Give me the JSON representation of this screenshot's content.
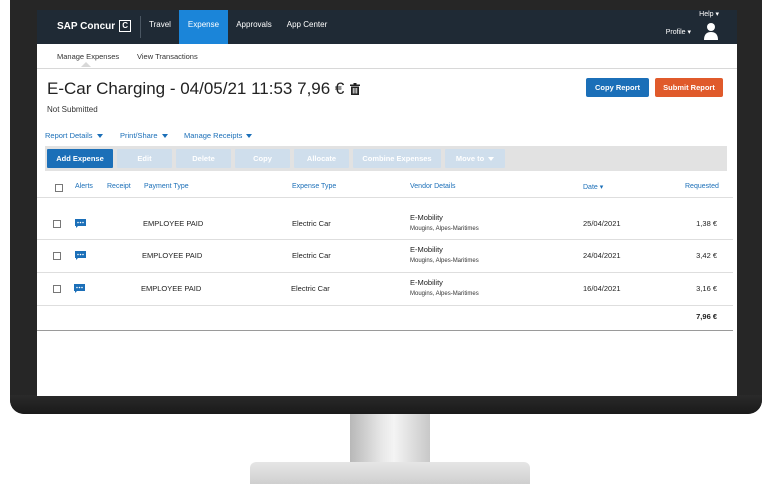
{
  "brand": {
    "name": "SAP Concur",
    "mark": "C"
  },
  "topnav": {
    "items": [
      {
        "label": "Travel"
      },
      {
        "label": "Expense"
      },
      {
        "label": "Approvals"
      },
      {
        "label": "App Center"
      }
    ],
    "help_label": "Help ▾",
    "profile_label": "Profile ▾"
  },
  "subnav": {
    "items": [
      {
        "label": "Manage Expenses"
      },
      {
        "label": "View Transactions"
      }
    ]
  },
  "report": {
    "title": "E-Car Charging - 04/05/21 11:53 7,96 €",
    "status": "Not Submitted",
    "copy_label": "Copy Report",
    "submit_label": "Submit Report"
  },
  "menus": [
    {
      "label": "Report Details"
    },
    {
      "label": "Print/Share"
    },
    {
      "label": "Manage Receipts"
    }
  ],
  "toolbar": {
    "add_expense": "Add Expense",
    "edit": "Edit",
    "delete": "Delete",
    "copy": "Copy",
    "allocate": "Allocate",
    "combine": "Combine Expenses",
    "move_to": "Move to"
  },
  "table": {
    "headers": {
      "alerts": "Alerts",
      "receipt": "Receipt",
      "payment_type": "Payment Type",
      "expense_type": "Expense Type",
      "vendor": "Vendor Details",
      "date": "Date ▾",
      "requested": "Requested"
    },
    "rows": [
      {
        "payment_type": "EMPLOYEE PAID",
        "expense_type": "Electric Car",
        "vendor": "E-Mobility",
        "location": "Mougins, Alpes-Maritimes",
        "date": "25/04/2021",
        "amount": "1,38 €"
      },
      {
        "payment_type": "EMPLOYEE PAID",
        "expense_type": "Electric Car",
        "vendor": "E-Mobility",
        "location": "Mougins, Alpes-Maritimes",
        "date": "24/04/2021",
        "amount": "3,42 €"
      },
      {
        "payment_type": "EMPLOYEE PAID",
        "expense_type": "Electric Car",
        "vendor": "E-Mobility",
        "location": "Mougins, Alpes-Maritimes",
        "date": "16/04/2021",
        "amount": "3,16 €"
      }
    ],
    "total": "7,96 €"
  },
  "colors": {
    "nav_bg": "#1f2a35",
    "accent": "#1b85d9",
    "primary": "#1b6fb8",
    "submit": "#e05a2b"
  }
}
